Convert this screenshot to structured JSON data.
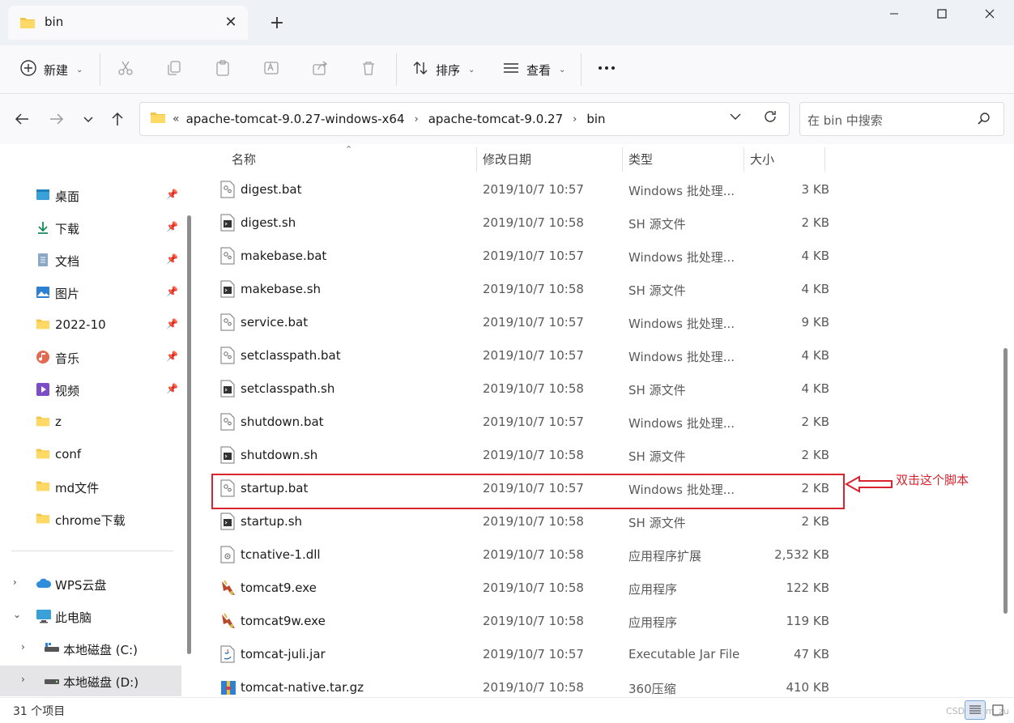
{
  "window": {
    "tab_title": "bin",
    "colors": {
      "accent": "#005fb8",
      "annotation": "#d9232e",
      "folder": "#f4c542"
    }
  },
  "toolbar": {
    "new_label": "新建",
    "sort_label": "排序",
    "view_label": "查看"
  },
  "address": {
    "crumbs": [
      "apache-tomcat-9.0.27-windows-x64",
      "apache-tomcat-9.0.27",
      "bin"
    ],
    "search_placeholder": "在 bin 中搜索"
  },
  "sidebar": {
    "quick_access": [
      {
        "label": "桌面",
        "icon": "desktop-icon",
        "pinned": true
      },
      {
        "label": "下载",
        "icon": "download-icon",
        "pinned": true
      },
      {
        "label": "文档",
        "icon": "document-icon",
        "pinned": true
      },
      {
        "label": "图片",
        "icon": "pictures-icon",
        "pinned": true
      },
      {
        "label": "2022-10",
        "icon": "folder-icon",
        "pinned": true
      },
      {
        "label": "音乐",
        "icon": "music-icon",
        "pinned": true
      },
      {
        "label": "视频",
        "icon": "video-icon",
        "pinned": true
      },
      {
        "label": "z",
        "icon": "folder-icon",
        "pinned": false
      },
      {
        "label": "conf",
        "icon": "folder-icon",
        "pinned": false
      },
      {
        "label": "md文件",
        "icon": "folder-icon",
        "pinned": false
      },
      {
        "label": "chrome下载",
        "icon": "folder-icon",
        "pinned": false
      }
    ],
    "tree": [
      {
        "label": "WPS云盘",
        "icon": "cloud-icon",
        "expanded": false
      },
      {
        "label": "此电脑",
        "icon": "computer-icon",
        "expanded": true
      },
      {
        "label": "本地磁盘 (C:)",
        "icon": "drive-icon",
        "expanded": false
      },
      {
        "label": "本地磁盘 (D:)",
        "icon": "drive-icon",
        "expanded": false,
        "selected": true
      }
    ]
  },
  "columns": {
    "name": "名称",
    "date": "修改日期",
    "type": "类型",
    "size": "大小"
  },
  "files": [
    {
      "name": "digest.bat",
      "date": "2019/10/7 10:57",
      "type": "Windows 批处理...",
      "size": "3 KB",
      "icon": "bat-file-icon"
    },
    {
      "name": "digest.sh",
      "date": "2019/10/7 10:58",
      "type": "SH 源文件",
      "size": "2 KB",
      "icon": "sh-file-icon"
    },
    {
      "name": "makebase.bat",
      "date": "2019/10/7 10:57",
      "type": "Windows 批处理...",
      "size": "4 KB",
      "icon": "bat-file-icon"
    },
    {
      "name": "makebase.sh",
      "date": "2019/10/7 10:58",
      "type": "SH 源文件",
      "size": "4 KB",
      "icon": "sh-file-icon"
    },
    {
      "name": "service.bat",
      "date": "2019/10/7 10:57",
      "type": "Windows 批处理...",
      "size": "9 KB",
      "icon": "bat-file-icon"
    },
    {
      "name": "setclasspath.bat",
      "date": "2019/10/7 10:57",
      "type": "Windows 批处理...",
      "size": "4 KB",
      "icon": "bat-file-icon"
    },
    {
      "name": "setclasspath.sh",
      "date": "2019/10/7 10:58",
      "type": "SH 源文件",
      "size": "4 KB",
      "icon": "sh-file-icon"
    },
    {
      "name": "shutdown.bat",
      "date": "2019/10/7 10:57",
      "type": "Windows 批处理...",
      "size": "2 KB",
      "icon": "bat-file-icon"
    },
    {
      "name": "shutdown.sh",
      "date": "2019/10/7 10:58",
      "type": "SH 源文件",
      "size": "2 KB",
      "icon": "sh-file-icon"
    },
    {
      "name": "startup.bat",
      "date": "2019/10/7 10:57",
      "type": "Windows 批处理...",
      "size": "2 KB",
      "icon": "bat-file-icon"
    },
    {
      "name": "startup.sh",
      "date": "2019/10/7 10:58",
      "type": "SH 源文件",
      "size": "2 KB",
      "icon": "sh-file-icon"
    },
    {
      "name": "tcnative-1.dll",
      "date": "2019/10/7 10:58",
      "type": "应用程序扩展",
      "size": "2,532 KB",
      "icon": "dll-file-icon"
    },
    {
      "name": "tomcat9.exe",
      "date": "2019/10/7 10:58",
      "type": "应用程序",
      "size": "122 KB",
      "icon": "tomcat-exe-icon"
    },
    {
      "name": "tomcat9w.exe",
      "date": "2019/10/7 10:58",
      "type": "应用程序",
      "size": "119 KB",
      "icon": "tomcat-exe-icon"
    },
    {
      "name": "tomcat-juli.jar",
      "date": "2019/10/7 10:57",
      "type": "Executable Jar File",
      "size": "47 KB",
      "icon": "jar-file-icon"
    },
    {
      "name": "tomcat-native.tar.gz",
      "date": "2019/10/7 10:58",
      "type": "360压缩",
      "size": "410 KB",
      "icon": "archive-icon"
    }
  ],
  "annotation": {
    "text": "双击这个脚本"
  },
  "status": {
    "item_count": "31 个项目"
  },
  "watermark": "CSDN @lm_zu"
}
